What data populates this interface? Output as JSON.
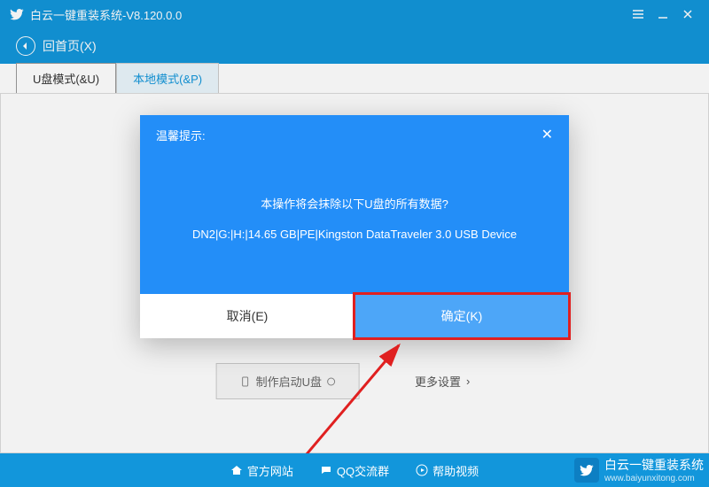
{
  "titlebar": {
    "title": "白云一键重装系统-V8.120.0.0"
  },
  "breadcrumb": {
    "back_label": "回首页(X)"
  },
  "tabs": {
    "usb": "U盘模式(&U)",
    "local": "本地模式(&P)"
  },
  "buttons": {
    "make_boot": "制作启动U盘",
    "more_settings": "更多设置"
  },
  "modal": {
    "title": "温馨提示:",
    "line1": "本操作将会抹除以下U盘的所有数据?",
    "line2": "DN2|G:|H:|14.65 GB|PE|Kingston DataTraveler 3.0 USB Device",
    "cancel": "取消(E)",
    "confirm": "确定(K)"
  },
  "footer": {
    "site": "官方网站",
    "qq": "QQ交流群",
    "help": "帮助视频"
  },
  "watermark": {
    "name": "白云一键重装系统",
    "url": "www.baiyunxitong.com"
  }
}
